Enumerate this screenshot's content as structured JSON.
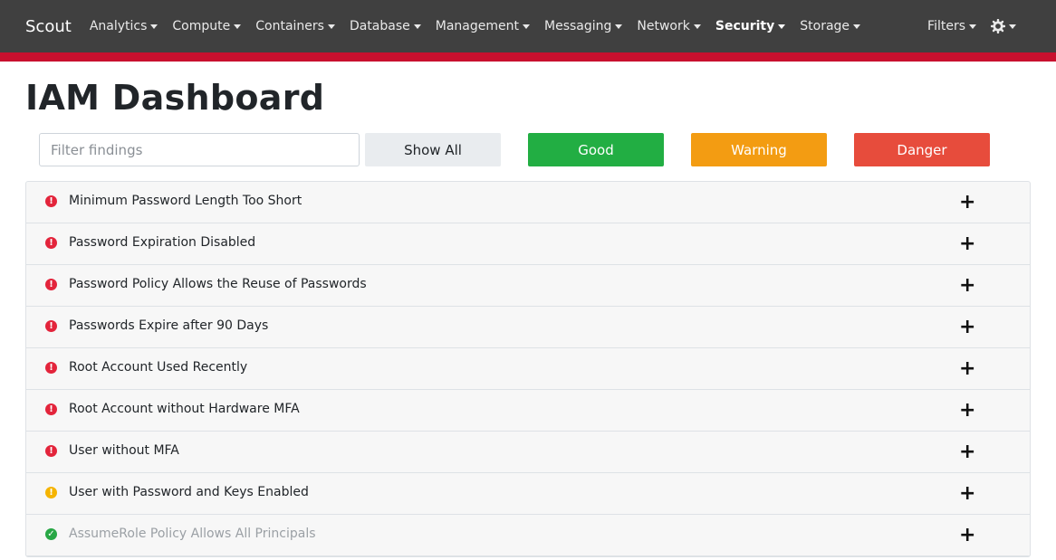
{
  "navbar": {
    "brand": "Scout",
    "items": [
      {
        "label": "Analytics",
        "active": false
      },
      {
        "label": "Compute",
        "active": false
      },
      {
        "label": "Containers",
        "active": false
      },
      {
        "label": "Database",
        "active": false
      },
      {
        "label": "Management",
        "active": false
      },
      {
        "label": "Messaging",
        "active": false
      },
      {
        "label": "Network",
        "active": false
      },
      {
        "label": "Security",
        "active": true
      },
      {
        "label": "Storage",
        "active": false
      }
    ],
    "filters_label": "Filters",
    "settings_icon": "gear-icon",
    "accent_color": "#c8102e"
  },
  "page": {
    "title": "IAM Dashboard"
  },
  "filters": {
    "placeholder": "Filter findings",
    "show_all_label": "Show All",
    "good_label": "Good",
    "warning_label": "Warning",
    "danger_label": "Danger",
    "colors": {
      "good": "#22ae43",
      "warning": "#f39c12",
      "danger": "#e74c3c"
    }
  },
  "findings": [
    {
      "title": "Minimum Password Length Too Short",
      "level": "danger"
    },
    {
      "title": "Password Expiration Disabled",
      "level": "danger"
    },
    {
      "title": "Password Policy Allows the Reuse of Passwords",
      "level": "danger"
    },
    {
      "title": "Passwords Expire after 90 Days",
      "level": "danger"
    },
    {
      "title": "Root Account Used Recently",
      "level": "danger"
    },
    {
      "title": "Root Account without Hardware MFA",
      "level": "danger"
    },
    {
      "title": "User without MFA",
      "level": "danger"
    },
    {
      "title": "User with Password and Keys Enabled",
      "level": "warning"
    },
    {
      "title": "AssumeRole Policy Allows All Principals",
      "level": "good"
    }
  ],
  "expand_symbol": "+"
}
